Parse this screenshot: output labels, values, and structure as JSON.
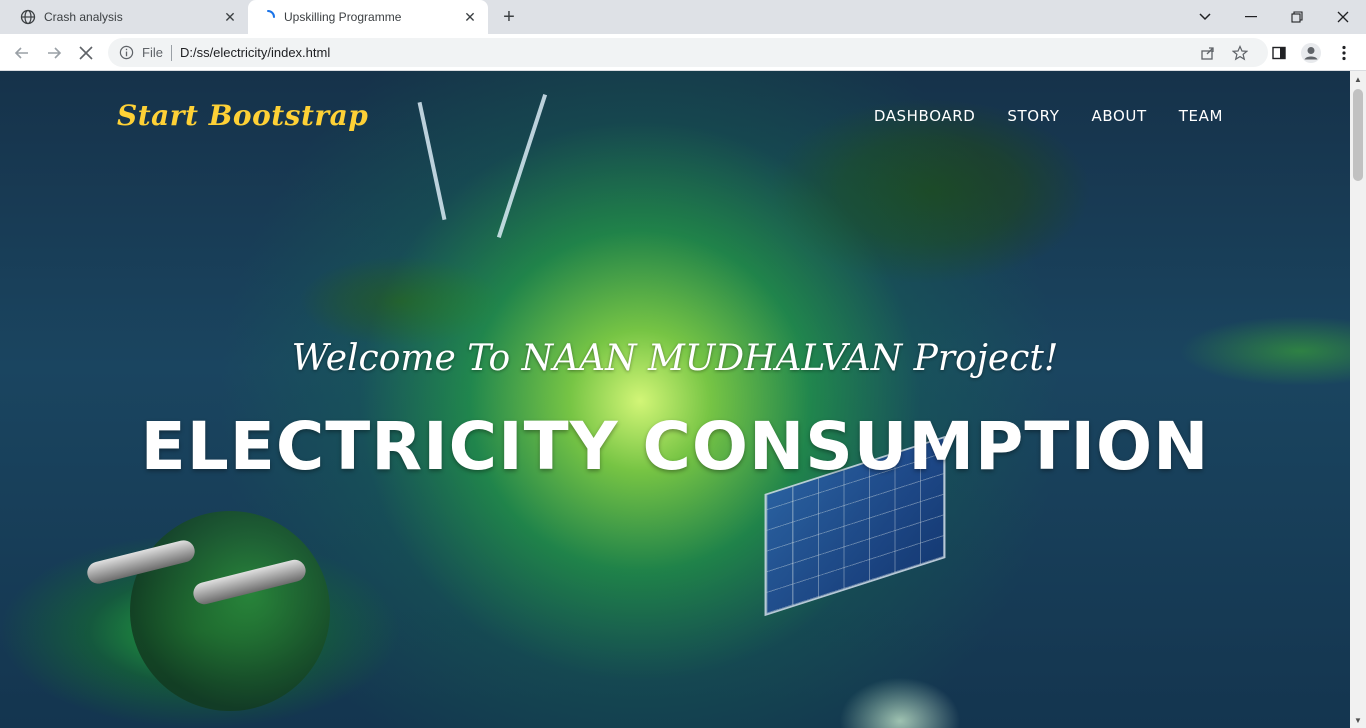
{
  "browser": {
    "tabs": [
      {
        "title": "Crash analysis",
        "icon": "globe-icon"
      },
      {
        "title": "Upskilling Programme",
        "icon": "loading-spinner-icon",
        "active": true
      }
    ],
    "address": {
      "scheme_label": "File",
      "url": "D:/ss/electricity/index.html"
    }
  },
  "page": {
    "brand": "Start Bootstrap",
    "nav": [
      "DASHBOARD",
      "STORY",
      "ABOUT",
      "TEAM"
    ],
    "hero": {
      "subheading": "Welcome To NAAN MUDHALVAN Project!",
      "heading": "ELECTRICITY CONSUMPTION"
    }
  },
  "colors": {
    "brand": "#fed136",
    "nav_text": "#ffffff",
    "tabstrip": "#dee1e6"
  }
}
